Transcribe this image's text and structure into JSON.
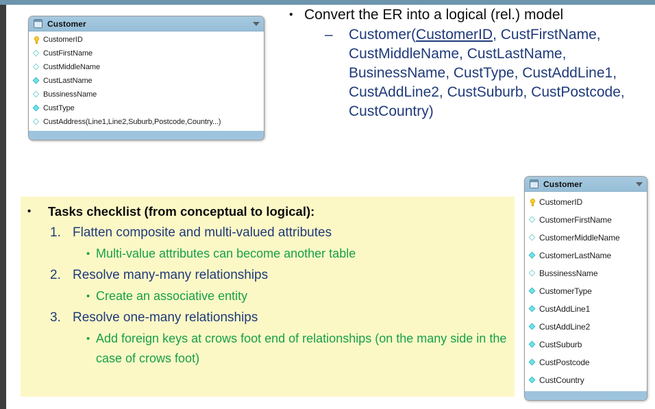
{
  "chrome": {
    "top_bar_color": "#6d96ad",
    "left_bar_color": "#3c3c3c"
  },
  "entity_top": {
    "icon": "table-icon",
    "title": "Customer",
    "caret": "▼",
    "attributes": [
      {
        "marker": "key",
        "label": "CustomerID"
      },
      {
        "marker": "diamond-hollow",
        "label": "CustFirstName"
      },
      {
        "marker": "diamond-hollow",
        "label": "CustMiddleName"
      },
      {
        "marker": "diamond-filled",
        "label": "CustLastName"
      },
      {
        "marker": "diamond-hollow",
        "label": "BussinessName"
      },
      {
        "marker": "diamond-filled",
        "label": "CustType"
      },
      {
        "marker": "diamond-hollow",
        "label": "CustAddress(Line1,Line2,Suburb,Postcode,Country...)"
      }
    ]
  },
  "entity_right": {
    "icon": "table-icon",
    "title": "Customer",
    "caret": "▼",
    "attributes": [
      {
        "marker": "key",
        "label": "CustomerID"
      },
      {
        "marker": "diamond-hollow",
        "label": "CustomerFirstName"
      },
      {
        "marker": "diamond-hollow",
        "label": "CustomerMiddleName"
      },
      {
        "marker": "diamond-filled",
        "label": "CustomerLastName"
      },
      {
        "marker": "diamond-hollow",
        "label": "BussinessName"
      },
      {
        "marker": "diamond-filled",
        "label": "CustomerType"
      },
      {
        "marker": "diamond-filled",
        "label": "CustAddLine1"
      },
      {
        "marker": "diamond-filled",
        "label": "CustAddLine2"
      },
      {
        "marker": "diamond-filled",
        "label": "CustSuburb"
      },
      {
        "marker": "diamond-filled",
        "label": "CustPostcode"
      },
      {
        "marker": "diamond-filled",
        "label": "CustCountry"
      }
    ]
  },
  "text_block": {
    "bullet_marker": "•",
    "dash_marker": "–",
    "level1_text": "Convert the ER into a logical (rel.) model",
    "relation_prefix": "Customer(",
    "relation_key": "CustomerID",
    "relation_rest": ", CustFirstName, CustMiddleName, CustLastName, BusinessName, CustType, CustAddLine1, CustAddLine2, CustSuburb, CustPostcode, CustCountry)"
  },
  "task_box": {
    "background_color": "#fcf8c6",
    "bullet_marker": "•",
    "heading": "Tasks checklist (from conceptual to logical):",
    "items": [
      {
        "number": "1.",
        "text": "Flatten composite and multi-valued attributes",
        "sub": "Multi-value attributes can become another table"
      },
      {
        "number": "2.",
        "text": "Resolve many-many relationships",
        "sub": "Create an associative entity"
      },
      {
        "number": "3.",
        "text": "Resolve one-many relationships",
        "sub": "Add foreign keys at crows foot end of relationships (on the many side in the case of crows foot)"
      }
    ]
  },
  "colors": {
    "entity_header": "#9fc5de",
    "blue_text": "#1f3a7a",
    "green_text": "#18a04a",
    "black_text": "#0d0d0d"
  }
}
